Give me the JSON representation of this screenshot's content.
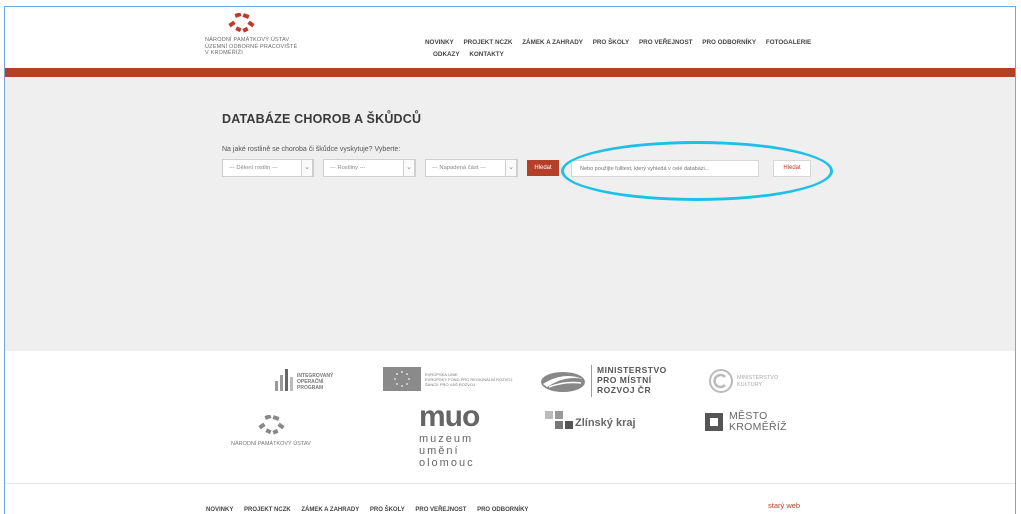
{
  "header": {
    "logo_lines": [
      "NÁRODNÍ PAMÁTKOVÝ ÚSTAV",
      "ÚZEMNÍ ODBORNÉ PRACOVIŠTĚ",
      "V KROMĚŘÍŽI"
    ],
    "nav_row1": [
      "NOVINKY",
      "PROJEKT NCZK",
      "ZÁMEK A ZAHRADY",
      "PRO ŠKOLY",
      "PRO VEŘEJNOST",
      "PRO ODBORNÍKY",
      "FOTOGALERIE"
    ],
    "nav_row2": [
      "ODKAZY",
      "KONTAKTY"
    ]
  },
  "main": {
    "title": "DATABÁZE CHOROB A ŠKŮDCŮ",
    "question": "Na jaké rostlině se choroba či škůdce vyskytuje? Vyberte:",
    "selects": [
      {
        "value": "--- Dělení rostlin ---"
      },
      {
        "value": "--- Rostliny ---"
      },
      {
        "value": "--- Napadená část ---"
      }
    ],
    "search_button": "Hledat",
    "fulltext_placeholder": "Nebo použijte fulltext, který vyhledá v celé databázi...",
    "fulltext_button": "Hledat",
    "highlight_color": "#1ec0e6",
    "accent_color": "#b5402a"
  },
  "sponsors": {
    "iop_lines": [
      "INTEGROVANÝ",
      "OPERAČNÍ",
      "PROGRAM"
    ],
    "eu_lines": [
      "EVROPSKÁ UNIE",
      "EVROPSKÝ FOND PRO REGIONÁLNÍ ROZVOJ",
      "ŠANCE PRO VÁŠ ROZVOJ"
    ],
    "mmr_lines": [
      "MINISTERSTVO",
      "PRO MÍSTNÍ",
      "ROZVOJ ČR"
    ],
    "mk_lines": [
      "MINISTERSTVO",
      "KULTURY"
    ],
    "npu_label": "NÁRODNÍ PAMÁTKOVÝ ÚSTAV",
    "muo_big": "muo",
    "muo_lines": [
      "muzeum",
      "umění",
      "olomouc"
    ],
    "zlin_label": "Zlínský kraj",
    "mesto_lines": [
      "MĚSTO",
      "KROMĚŘÍŽ"
    ]
  },
  "footer": {
    "nav": [
      "NOVINKY",
      "PROJEKT NCZK",
      "ZÁMEK A ZAHRADY",
      "PRO ŠKOLY",
      "PRO VEŘEJNOST",
      "PRO ODBORNÍKY"
    ],
    "old_web": "starý web"
  }
}
